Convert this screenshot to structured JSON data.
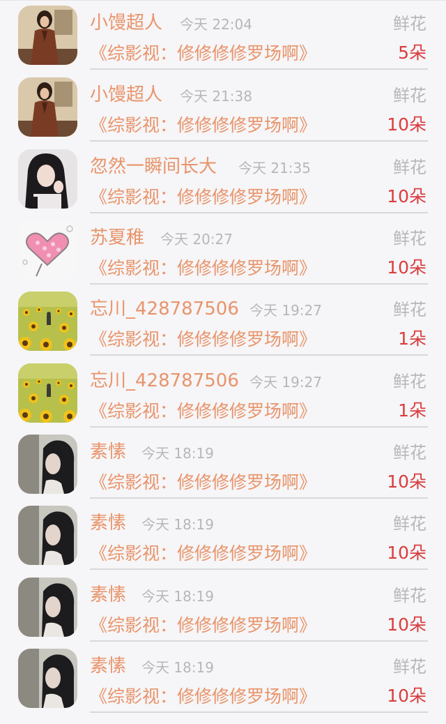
{
  "records": [
    {
      "name": "小馒超人",
      "time": "今天 22:04",
      "gift_type": "鲜花",
      "work_title": "《综影视：修修修修罗场啊》",
      "count": "5朵",
      "avatar_icon": "woman-in-coat-avatar"
    },
    {
      "name": "小馒超人",
      "time": "今天 21:38",
      "gift_type": "鲜花",
      "work_title": "《综影视：修修修修罗场啊》",
      "count": "10朵",
      "avatar_icon": "woman-in-coat-avatar"
    },
    {
      "name": "忽然一瞬间长大",
      "time": "今天 21:35",
      "gift_type": "鲜花",
      "work_title": "《综影视：修修修修罗场啊》",
      "count": "10朵",
      "avatar_icon": "dark-hair-girl-avatar"
    },
    {
      "name": "苏夏稚",
      "time": "今天 20:27",
      "gift_type": "鲜花",
      "work_title": "《综影视：修修修修罗场啊》",
      "count": "10朵",
      "avatar_icon": "pink-heart-avatar"
    },
    {
      "name": "忘川_428787506",
      "time": "今天 19:27",
      "gift_type": "鲜花",
      "work_title": "《综影视：修修修修罗场啊》",
      "count": "1朵",
      "avatar_icon": "sunflower-field-avatar"
    },
    {
      "name": "忘川_428787506",
      "time": "今天 19:27",
      "gift_type": "鲜花",
      "work_title": "《综影视：修修修修罗场啊》",
      "count": "1朵",
      "avatar_icon": "sunflower-field-avatar"
    },
    {
      "name": "素愫",
      "time": "今天 18:19",
      "gift_type": "鲜花",
      "work_title": "《综影视：修修修修罗场啊》",
      "count": "10朵",
      "avatar_icon": "long-hair-girl-avatar"
    },
    {
      "name": "素愫",
      "time": "今天 18:19",
      "gift_type": "鲜花",
      "work_title": "《综影视：修修修修罗场啊》",
      "count": "10朵",
      "avatar_icon": "long-hair-girl-avatar"
    },
    {
      "name": "素愫",
      "time": "今天 18:19",
      "gift_type": "鲜花",
      "work_title": "《综影视：修修修修罗场啊》",
      "count": "10朵",
      "avatar_icon": "long-hair-girl-avatar"
    },
    {
      "name": "素愫",
      "time": "今天 18:19",
      "gift_type": "鲜花",
      "work_title": "《综影视：修修修修罗场啊》",
      "count": "10朵",
      "avatar_icon": "long-hair-girl-avatar"
    }
  ],
  "colors": {
    "name": "#e8946a",
    "work_title": "#e8946a",
    "count": "#d93d3f",
    "secondary_text": "#b7b6ba",
    "background": "#f6f5f7"
  }
}
